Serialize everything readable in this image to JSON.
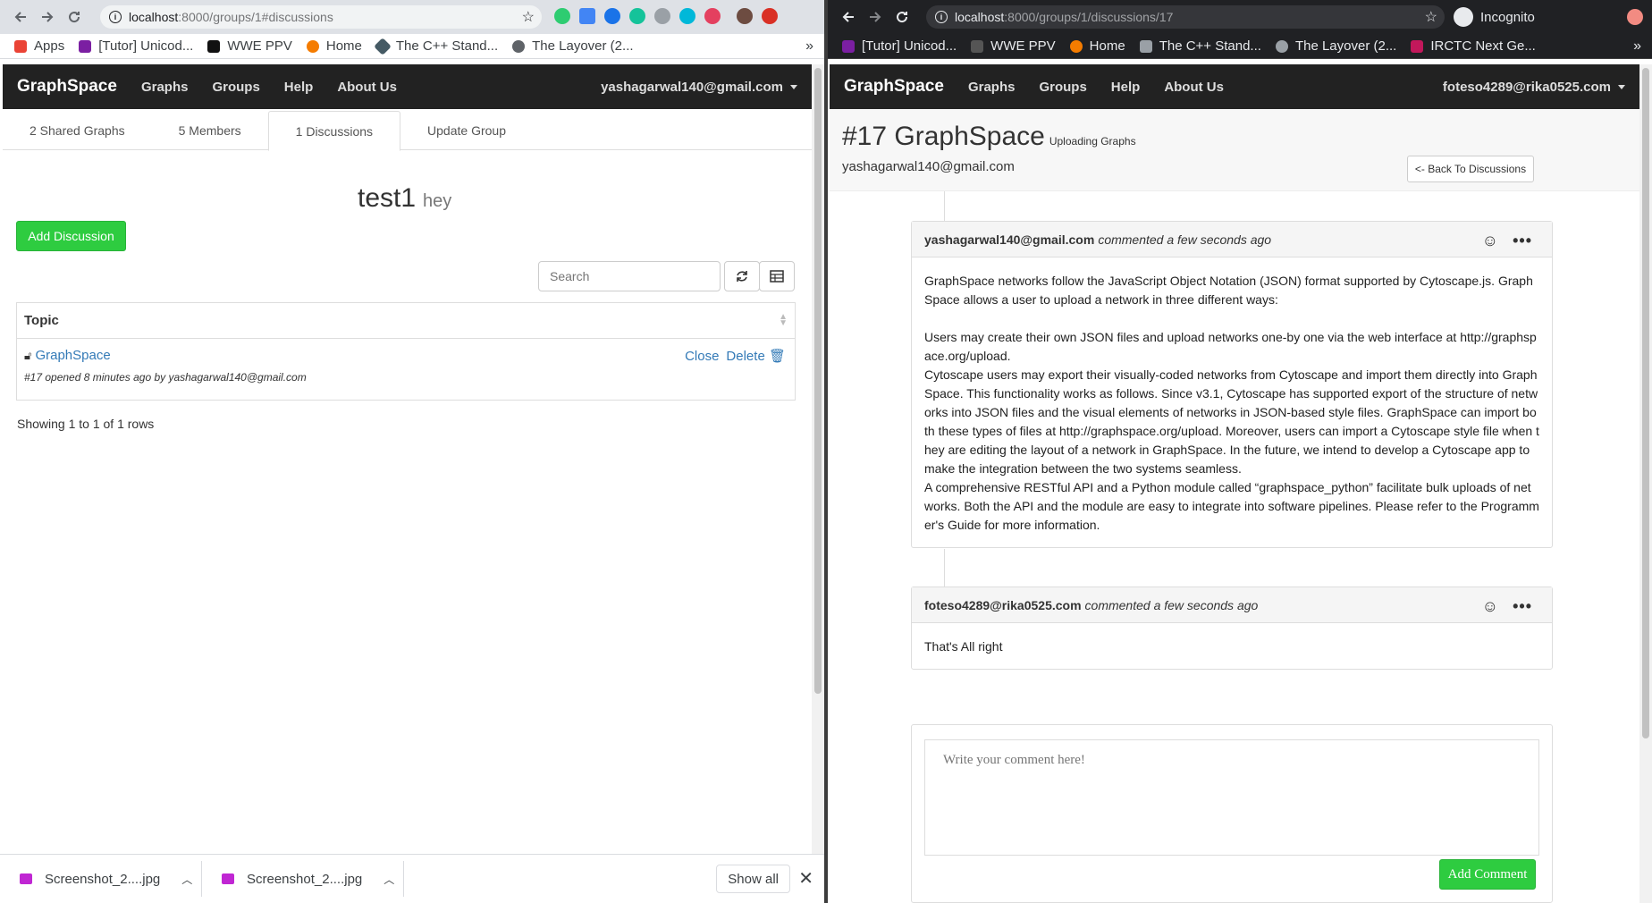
{
  "left_window": {
    "url_host": "localhost",
    "url_path": ":8000/groups/1#discussions",
    "bookmarks": [
      "Apps",
      "[Tutor] Unicod...",
      "WWE PPV",
      "Home",
      "The C++ Stand...",
      "The Layover (2..."
    ],
    "nav": {
      "brand": "GraphSpace",
      "links": [
        "Graphs",
        "Groups",
        "Help",
        "About Us"
      ],
      "user": "yashagarwal140@gmail.com"
    },
    "tabs": [
      "2 Shared Graphs",
      "5 Members",
      "1 Discussions",
      "Update Group"
    ],
    "group_title": "test1",
    "group_subtitle": "hey",
    "add_discussion_label": "Add Discussion",
    "search_placeholder": "Search",
    "table": {
      "header": "Topic",
      "rows": [
        {
          "topic": "GraphSpace",
          "meta": "#17 opened 8 minutes ago by yashagarwal140@gmail.com",
          "close": "Close",
          "delete": "Delete"
        }
      ]
    },
    "pagination": "Showing 1 to 1 of 1 rows",
    "downloads": [
      "Screenshot_2....jpg",
      "Screenshot_2....jpg"
    ],
    "show_all": "Show all"
  },
  "right_window": {
    "url_host": "localhost",
    "url_path": ":8000/groups/1/discussions/17",
    "incognito_label": "Incognito",
    "bookmarks": [
      "[Tutor] Unicod...",
      "WWE PPV",
      "Home",
      "The C++ Stand...",
      "The Layover (2...",
      "IRCTC Next Ge..."
    ],
    "nav": {
      "brand": "GraphSpace",
      "links": [
        "Graphs",
        "Groups",
        "Help",
        "About Us"
      ],
      "user": "foteso4289@rika0525.com"
    },
    "discussion": {
      "number_title": "#17 GraphSpace",
      "subtitle": "Uploading Graphs",
      "author": "yashagarwal140@gmail.com",
      "back_label": "<- Back To Discussions"
    },
    "comments": [
      {
        "author": "yashagarwal140@gmail.com",
        "when": "commented a few seconds ago",
        "paragraphs": [
          "GraphSpace networks follow the JavaScript Object Notation (JSON) format supported by Cytoscape.js. Graph Space allows a user to upload a network in three different ways:",
          "",
          "Users may create their own JSON files and upload networks one-by one via the web interface at http://graphspace.org/upload.",
          "Cytoscape users may export their visually-coded networks from Cytoscape and import them directly into Graph Space. This functionality works as follows. Since v3.1, Cytoscape has supported export of the structure of networks into JSON files and the visual elements of networks in JSON-based style files. GraphSpace can import both these types of files at http://graphspace.org/upload. Moreover, users can import a Cytoscape style file when they are editing the layout of a network in GraphSpace. In the future, we intend to develop a Cytoscape app to make the integration between the two systems seamless.",
          "A comprehensive RESTful API and a Python module called “graphspace_python” facilitate bulk uploads of networks. Both the API and the module are easy to integrate into software pipelines. Please refer to the Programmer's Guide for more information."
        ]
      },
      {
        "author": "foteso4289@rika0525.com",
        "when": "commented a few seconds ago",
        "paragraphs": [
          "That's All right"
        ]
      }
    ],
    "comment_placeholder": "Write your comment here!",
    "add_comment_label": "Add Comment"
  }
}
